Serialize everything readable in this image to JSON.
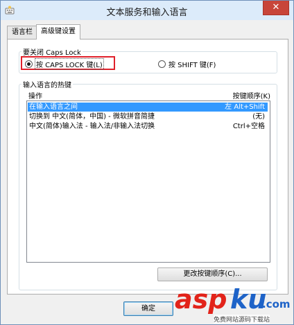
{
  "window": {
    "title": "文本服务和输入语言",
    "close_glyph": "✕"
  },
  "tabs": [
    {
      "label": "语言栏",
      "active": false
    },
    {
      "label": "高级键设置",
      "active": true
    }
  ],
  "caps_lock": {
    "legend": "要关闭 Caps Lock",
    "option_caps": "按 CAPS LOCK 键(L)",
    "option_shift": "按 SHIFT 键(F)",
    "selected": "option_caps"
  },
  "hotkeys": {
    "legend": "输入语言的热键",
    "col_action": "操作",
    "col_key": "按键顺序(K)",
    "rows": [
      {
        "action": "在输入语言之间",
        "key": "左 Alt+Shift",
        "selected": true
      },
      {
        "action": "切换到 中文(简体，中国) - 微软拼音简捷",
        "key": "(无)",
        "selected": false
      },
      {
        "action": "中文(简体)输入法 - 输入法/非输入法切换",
        "key": "Ctrl+空格",
        "selected": false
      }
    ],
    "change_button": "更改按键顺序(C)..."
  },
  "footer": {
    "ok_button": "确定"
  },
  "watermark": {
    "brand_a": "asp",
    "brand_b": "ku",
    "brand_c": ".com",
    "subtitle": "免费网站源码下载站",
    "color_a": "#e2231a",
    "color_b": "#1e63c8"
  }
}
